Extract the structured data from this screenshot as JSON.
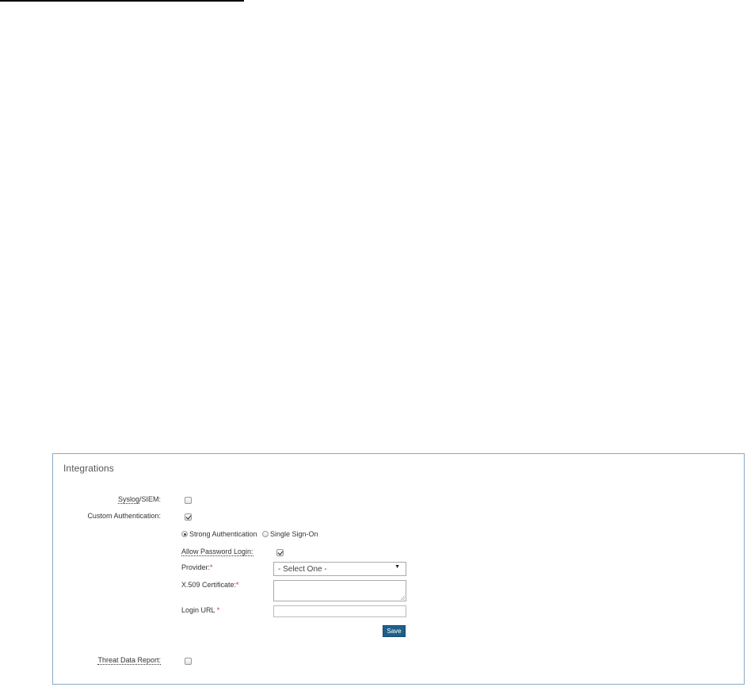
{
  "panel": {
    "title": "Integrations"
  },
  "syslog": {
    "label_part1": "Syslog",
    "label_part2": "/SIEM:",
    "checked": false
  },
  "custom_auth": {
    "label": "Custom Authentication:",
    "checked": true,
    "radio_options": [
      {
        "label": "Strong Authentication",
        "selected": true
      },
      {
        "label": "Single Sign-On",
        "selected": false
      }
    ],
    "allow_password_login": {
      "label": "Allow Password Login:",
      "checked": true
    },
    "provider": {
      "label": "Provider:",
      "required": "*",
      "selected": "- Select One -"
    },
    "certificate": {
      "label": "X.509 Certificate:",
      "required": "*"
    },
    "login_url": {
      "label": "Login URL",
      "required": "*"
    },
    "save_label": "Save"
  },
  "threat_report": {
    "label": "Threat Data Report:",
    "checked": false
  }
}
